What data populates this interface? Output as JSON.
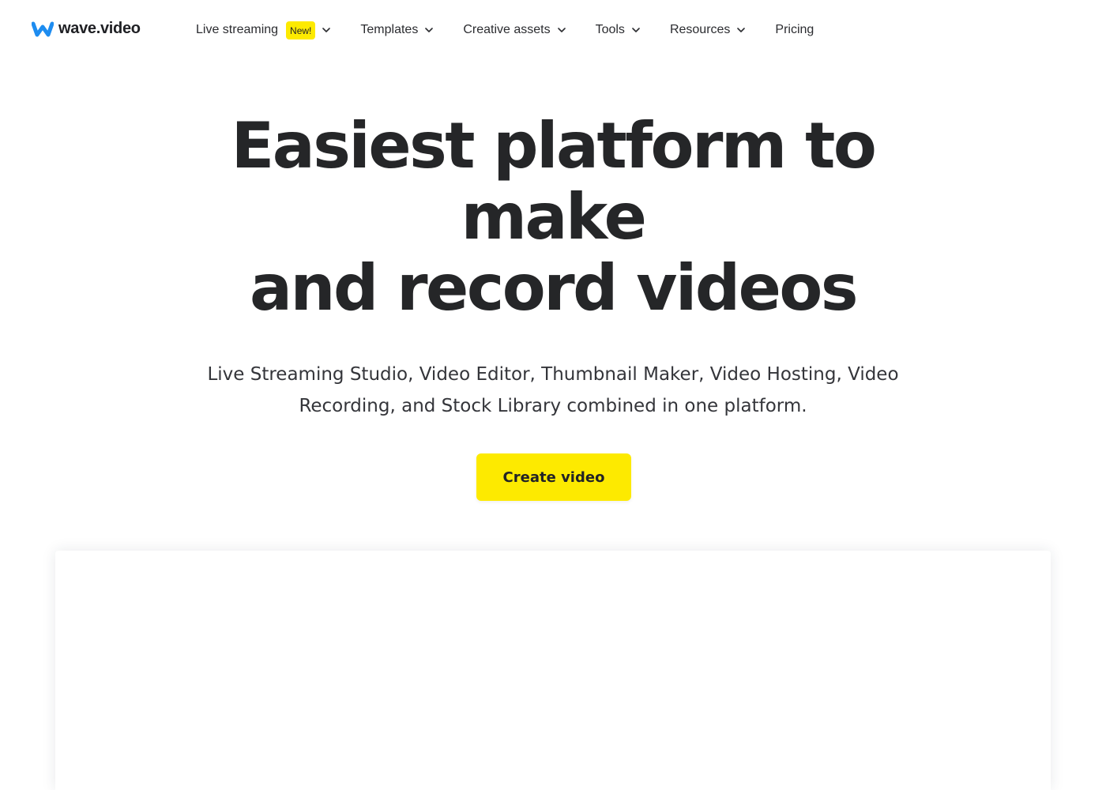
{
  "brand": {
    "name": "wave.video",
    "logo_color": "#1d8cf0"
  },
  "nav": {
    "items": [
      {
        "label": "Live streaming",
        "badge": "New!",
        "has_dropdown": true
      },
      {
        "label": "Templates",
        "has_dropdown": true
      },
      {
        "label": "Creative assets",
        "has_dropdown": true
      },
      {
        "label": "Tools",
        "has_dropdown": true
      },
      {
        "label": "Resources",
        "has_dropdown": true
      },
      {
        "label": "Pricing",
        "has_dropdown": false
      }
    ]
  },
  "hero": {
    "title_lines": [
      "Easiest platform to",
      "make",
      "and record videos"
    ],
    "subtitle_line_1": "Live Streaming Studio, Video Editor, Thumbnail Maker, Video Hosting, Video",
    "subtitle_line_2": "Recording, and Stock Library combined in one platform.",
    "cta_label": "Create video"
  },
  "colors": {
    "accent_yellow": "#fdea00",
    "text_dark": "#252628",
    "background": "#ffffff"
  }
}
